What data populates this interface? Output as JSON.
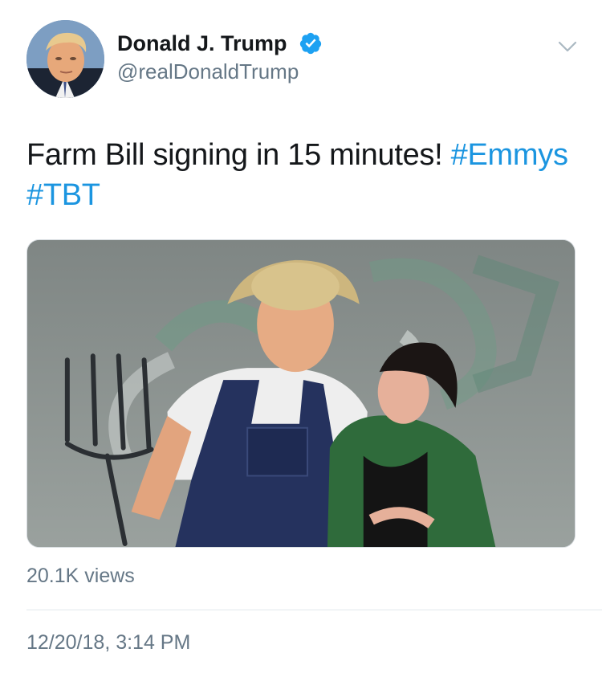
{
  "author": {
    "display_name": "Donald J. Trump",
    "handle": "@realDonaldTrump",
    "verified": true,
    "avatar_icon": "profile-photo"
  },
  "tweet": {
    "text_plain": "Farm Bill signing in 15 minutes! ",
    "hashtag_1": "#Emmys",
    "hashtag_2": "#TBT"
  },
  "media": {
    "type": "video"
  },
  "stats": {
    "views": "20.1K views"
  },
  "meta": {
    "timestamp": "12/20/18, 3:14 PM"
  },
  "colors": {
    "link": "#1b95e0",
    "secondary_text": "#657786",
    "verified_badge": "#1da1f2"
  },
  "icons": {
    "verified": "verified-badge-icon",
    "menu": "chevron-down-icon"
  }
}
